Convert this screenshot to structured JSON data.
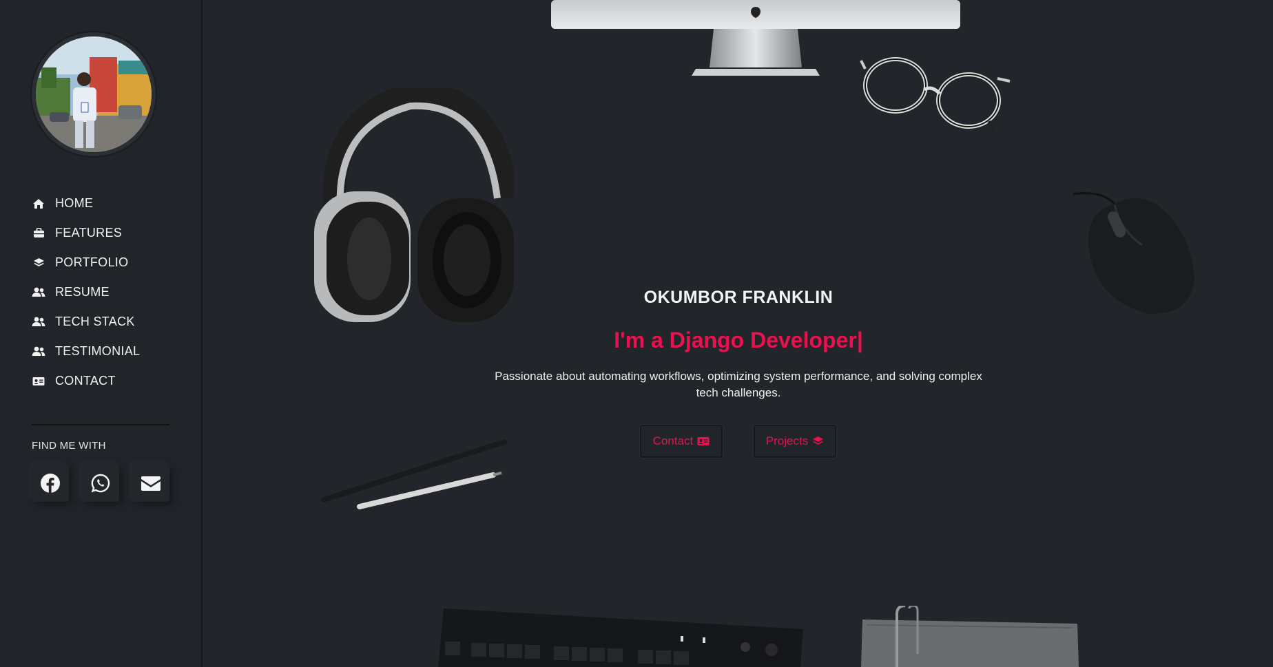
{
  "sidebar": {
    "nav": [
      {
        "label": "HOME",
        "icon": "home-icon"
      },
      {
        "label": "FEATURES",
        "icon": "briefcase-icon"
      },
      {
        "label": "PORTFOLIO",
        "icon": "layers-icon"
      },
      {
        "label": "RESUME",
        "icon": "users-icon"
      },
      {
        "label": "TECH STACK",
        "icon": "users-icon"
      },
      {
        "label": "TESTIMONIAL",
        "icon": "users-icon"
      },
      {
        "label": "CONTACT",
        "icon": "id-card-icon"
      }
    ],
    "find_me_label": "FIND ME WITH",
    "socials": [
      {
        "name": "facebook",
        "icon": "facebook-icon"
      },
      {
        "name": "whatsapp",
        "icon": "whatsapp-icon"
      },
      {
        "name": "email",
        "icon": "envelope-icon"
      }
    ]
  },
  "hero": {
    "name": "OKUMBOR FRANKLIN",
    "role": "I'm a Django Developer|",
    "description": "Passionate about automating workflows, optimizing system performance, and solving complex tech challenges.",
    "buttons": {
      "contact_label": "Contact",
      "projects_label": "Projects"
    }
  },
  "colors": {
    "accent": "#e7124f",
    "background": "#22252a",
    "sidebar": "#212428"
  }
}
